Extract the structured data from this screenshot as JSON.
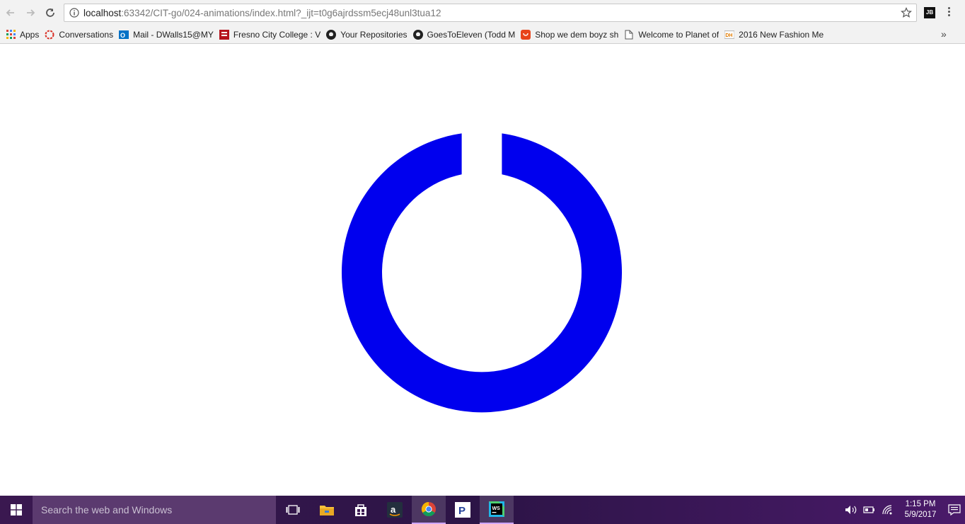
{
  "browser": {
    "url_host": "localhost",
    "url_rest": ":63342/CIT-go/024-animations/index.html?_ijt=t0g6ajrdssm5ecj48unl3tua12",
    "extension_label": "JB"
  },
  "bookmarks": [
    {
      "label": "Apps",
      "icon": "apps-grid-icon"
    },
    {
      "label": "Conversations",
      "icon": "conversations-icon"
    },
    {
      "label": "Mail - DWalls15@MY",
      "icon": "outlook-icon"
    },
    {
      "label": "Fresno City College : V",
      "icon": "fcc-icon"
    },
    {
      "label": "Your Repositories",
      "icon": "github-icon"
    },
    {
      "label": "GoesToEleven (Todd M",
      "icon": "github-icon"
    },
    {
      "label": "Shop we dem boyz sh",
      "icon": "shop-icon"
    },
    {
      "label": "Welcome to Planet of",
      "icon": "page-icon"
    },
    {
      "label": "2016 New Fashion Me",
      "icon": "dh-icon"
    }
  ],
  "bookmarks_more": "»",
  "content": {
    "ring_color": "#0000ee"
  },
  "taskbar": {
    "search_placeholder": "Search the web and Windows",
    "time": "1:15 PM",
    "date": "5/9/2017"
  }
}
